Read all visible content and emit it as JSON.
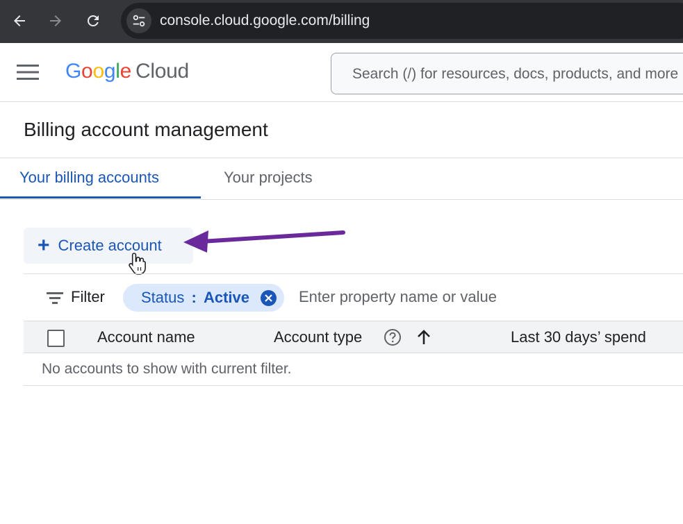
{
  "browser": {
    "url": "console.cloud.google.com/billing"
  },
  "header": {
    "logo_google": [
      "G",
      "o",
      "o",
      "g",
      "l",
      "e"
    ],
    "logo_product": "Cloud",
    "search_placeholder": "Search (/) for resources, docs, products, and more"
  },
  "page": {
    "title": "Billing account management"
  },
  "tabs": [
    {
      "label": "Your billing accounts",
      "active": true
    },
    {
      "label": "Your projects",
      "active": false
    }
  ],
  "toolbar": {
    "create_label": "Create account",
    "create_icon": "plus-icon"
  },
  "filter": {
    "label": "Filter",
    "chip_key": "Status",
    "chip_sep": ":",
    "chip_value": "Active",
    "input_placeholder": "Enter property name or value"
  },
  "table": {
    "columns": [
      "Account name",
      "Account type",
      "Last 30 days’ spend"
    ],
    "empty_message": "No accounts to show with current filter."
  },
  "colors": {
    "accent": "#1a56b8",
    "chip_bg": "#dce8fc",
    "annotation_arrow": "#6a2a9c"
  }
}
